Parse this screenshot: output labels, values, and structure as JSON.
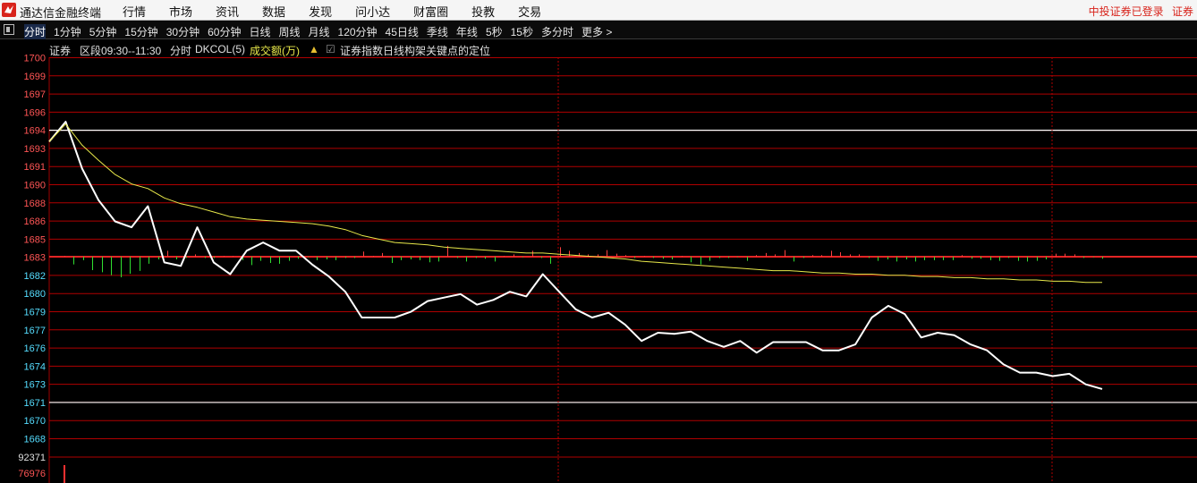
{
  "app": {
    "title": "通达信金融终端",
    "menu": [
      "行情",
      "市场",
      "资讯",
      "数据",
      "发现",
      "问小达",
      "财富圈",
      "投教",
      "交易"
    ],
    "status_login": "中投证券已登录",
    "status_broker": "证券"
  },
  "periods": {
    "active": "分时",
    "items": [
      "分时",
      "1分钟",
      "5分钟",
      "15分钟",
      "30分钟",
      "60分钟",
      "日线",
      "周线",
      "月线",
      "120分钟",
      "45日线",
      "季线",
      "年线",
      "5秒",
      "15秒",
      "多分时",
      "更多 >"
    ]
  },
  "chart_info": {
    "name": "证券",
    "range": "区段09:30--11:30",
    "period": "分时",
    "indicator": "DKCOL(5)",
    "volume_label": "成交额(万)",
    "checkbox_label": "证券指数日线构架关键点的定位"
  },
  "chart_data": {
    "type": "line",
    "price_ticks": [
      "1700",
      "1699",
      "1697",
      "1696",
      "1694",
      "1693",
      "1691",
      "1690",
      "1688",
      "1686",
      "1685",
      "1683",
      "1682",
      "1680",
      "1679",
      "1677",
      "1676",
      "1674",
      "1673",
      "1671",
      "1670",
      "1668"
    ],
    "volume_ticks": [
      "92371",
      "76976"
    ],
    "ylim": [
      1667.5,
      1700
    ],
    "white_line_levels": [
      1694,
      1671
    ],
    "series": [
      {
        "color": "#ffffff",
        "values": [
          1692.8,
          1694.5,
          1690.5,
          1687.8,
          1686,
          1685.5,
          1687.3,
          1682.5,
          1682.2,
          1685.5,
          1682.5,
          1681.5,
          1683.5,
          1684.2,
          1683.5,
          1683.5,
          1682.3,
          1681.3,
          1680,
          1677.8,
          1677.8,
          1677.8,
          1678.3,
          1679.2,
          1679.5,
          1679.8,
          1678.9,
          1679.3,
          1680,
          1679.6,
          1681.5,
          1680,
          1678.5,
          1677.8,
          1678.2,
          1677.2,
          1675.8,
          1676.5,
          1676.4,
          1676.6,
          1675.8,
          1675.3,
          1675.8,
          1674.8,
          1675.7,
          1675.7,
          1675.7,
          1675,
          1675,
          1675.5,
          1677.8,
          1678.8,
          1678.1,
          1676.1,
          1676.5,
          1676.3,
          1675.5,
          1675,
          1673.8,
          1673.1,
          1673.1,
          1672.8,
          1673,
          1672.1,
          1671.7
        ],
        "name": ""
      },
      {
        "color": "#e8e84a",
        "values": [
          1692.8,
          1694.3,
          1692.5,
          1691.2,
          1690.0,
          1689.2,
          1688.8,
          1688.0,
          1687.5,
          1687.2,
          1686.8,
          1686.4,
          1686.2,
          1686.1,
          1686.0,
          1685.9,
          1685.8,
          1685.6,
          1685.3,
          1684.8,
          1684.5,
          1684.2,
          1684.1,
          1684.0,
          1683.8,
          1683.7,
          1683.6,
          1683.5,
          1683.4,
          1683.3,
          1683.3,
          1683.2,
          1683.1,
          1683.0,
          1682.9,
          1682.8,
          1682.6,
          1682.5,
          1682.4,
          1682.3,
          1682.2,
          1682.1,
          1682.0,
          1681.9,
          1681.8,
          1681.8,
          1681.7,
          1681.6,
          1681.6,
          1681.5,
          1681.5,
          1681.4,
          1681.4,
          1681.3,
          1681.3,
          1681.2,
          1681.2,
          1681.1,
          1681.1,
          1681.0,
          1681.0,
          1680.9,
          1680.9,
          1680.8,
          1680.8
        ],
        "name": ""
      }
    ],
    "bars": [
      0.5,
      -5.5,
      -2.5,
      -9.5,
      -11,
      -13,
      -14.5,
      -12,
      -10,
      -5,
      -2,
      4,
      -2,
      -1,
      1.5,
      -1,
      -1,
      0.5,
      0.5,
      -2.5,
      -6,
      -3,
      -4.5,
      -5,
      -3,
      -1.5,
      -0.5,
      -2.5,
      -2,
      -2.5,
      -1,
      -1,
      3.5,
      0.5,
      2.5,
      -4.5,
      -2.5,
      -2,
      -2.5,
      -4,
      -3.5,
      7.5,
      -1,
      -3.5,
      -1,
      -1.5,
      -3.5,
      0.5,
      1.5,
      -0.5,
      4,
      -1,
      -5,
      6.5,
      4,
      2.5,
      1.5,
      1.5,
      4.5,
      2,
      1,
      -1,
      0.5,
      -1,
      -1.5,
      -2,
      0.5,
      -4,
      -5.5,
      -3,
      -1,
      -1,
      -0.5,
      -3,
      1,
      2.5,
      1.5,
      4.5,
      -3.5,
      -1,
      1,
      1,
      4,
      3,
      1.5,
      1.5,
      -1,
      -3,
      -2,
      -3.5,
      -2,
      -3.5,
      -2.5,
      -2.5,
      -2.5,
      -2.5,
      1,
      -1.5,
      -1.5,
      -2.5,
      -3,
      -1,
      -3,
      -3.5,
      -3,
      -2,
      2,
      2,
      1.5,
      -1,
      -0.5,
      -1.5
    ],
    "volume_marker": 92371
  }
}
